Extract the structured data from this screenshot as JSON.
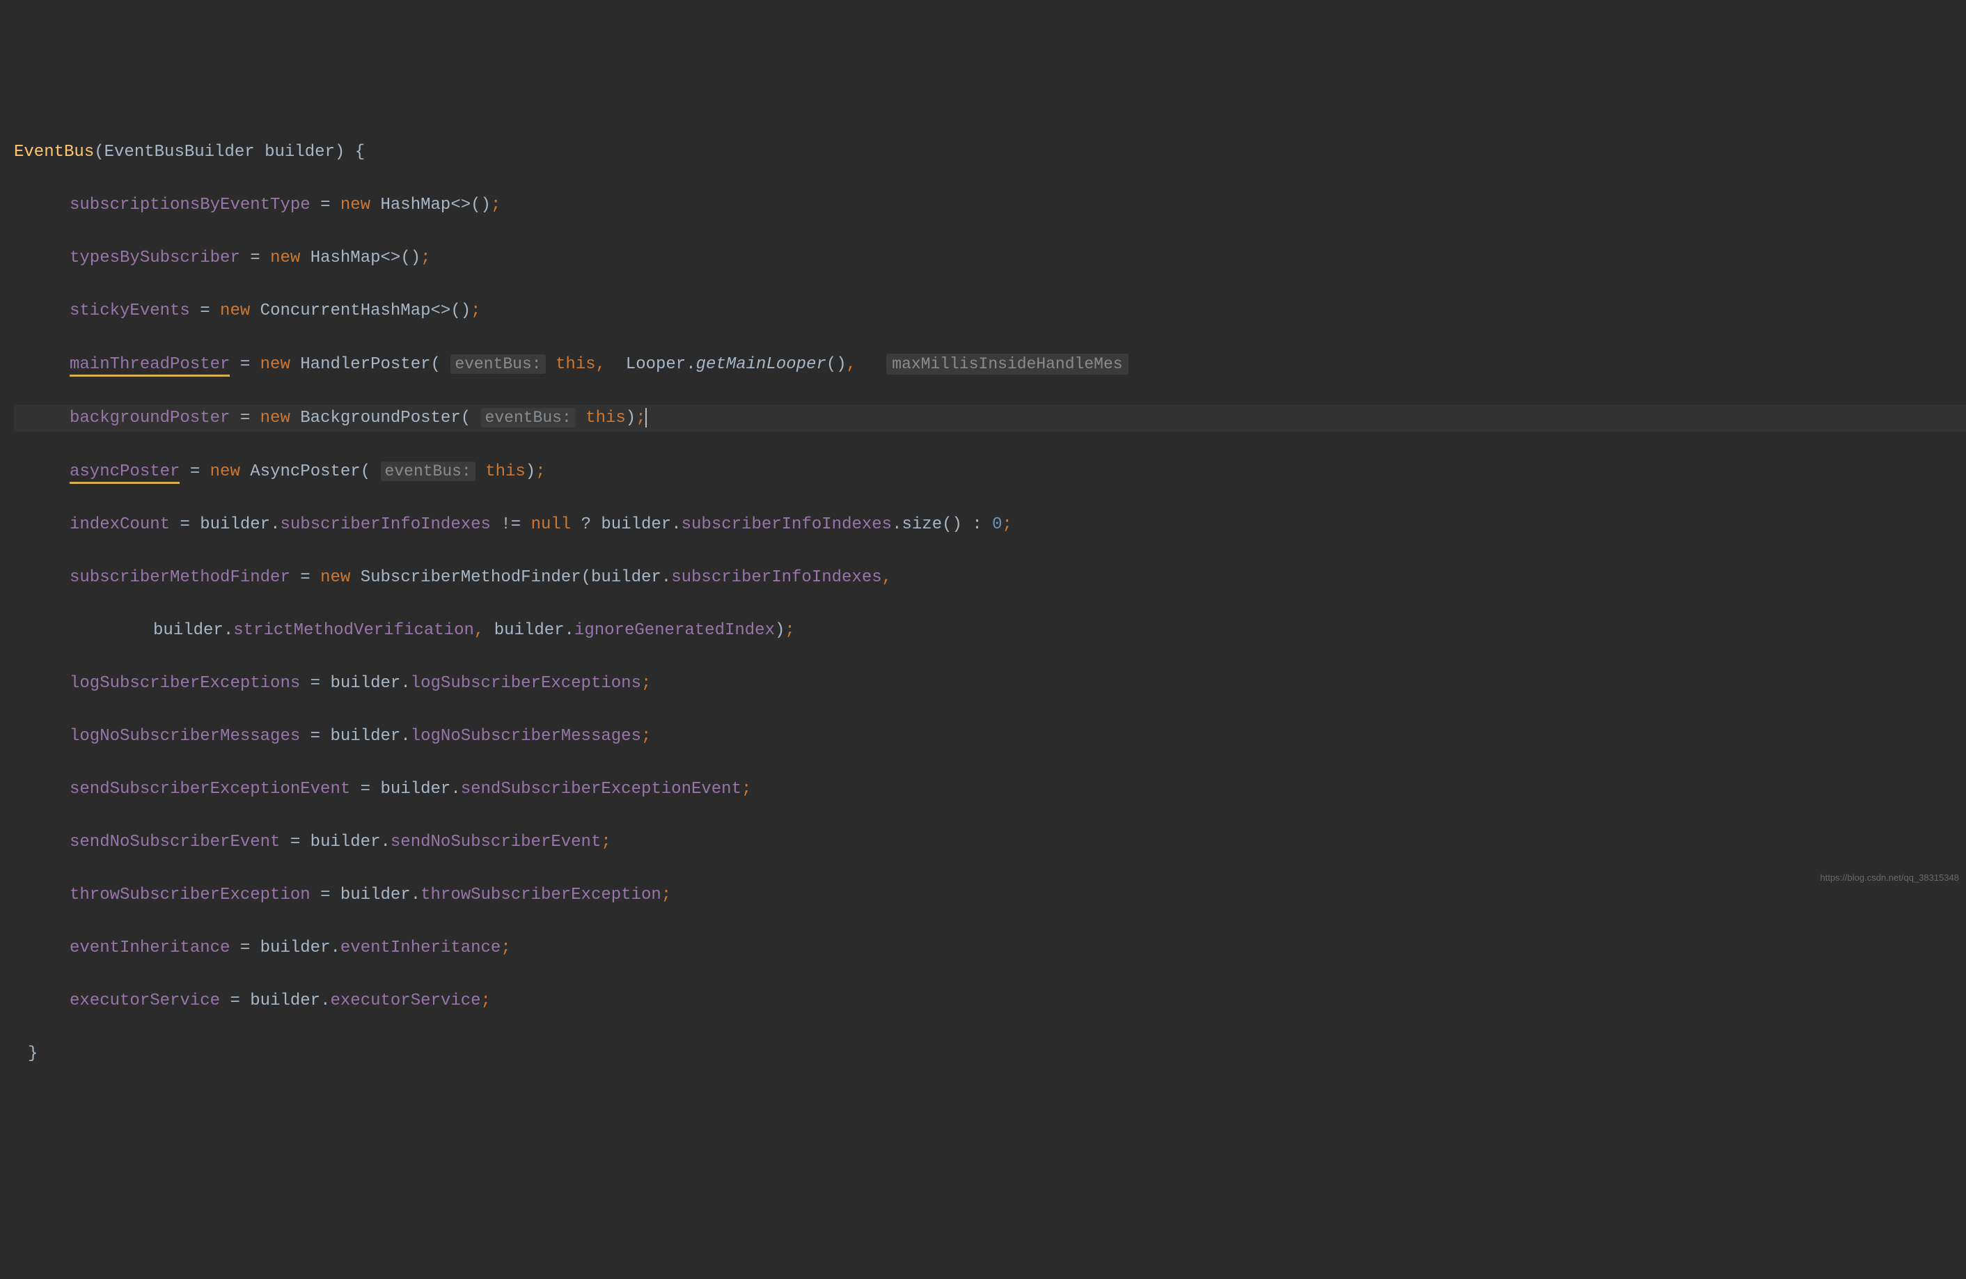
{
  "code": {
    "method_name": "EventBus",
    "param_type": "EventBusBuilder",
    "param_name": "builder",
    "kw_new": "new",
    "kw_this": "this",
    "kw_null": "null",
    "num_zero": "0",
    "l1_field": "subscriptionsByEventType",
    "l1_type": "HashMap",
    "l2_field": "typesBySubscriber",
    "l2_type": "HashMap",
    "l3_field": "stickyEvents",
    "l3_type": "ConcurrentHashMap",
    "l4_field": "mainThreadPoster",
    "l4_type": "HandlerPoster",
    "l4_hint1": "eventBus:",
    "l4_looper": "Looper",
    "l4_method": "getMainLooper",
    "l4_hint2": "maxMillisInsideHandleMes",
    "l5_field": "backgroundPoster",
    "l5_type": "BackgroundPoster",
    "l5_hint": "eventBus:",
    "l6_field": "asyncPoster",
    "l6_type": "AsyncPoster",
    "l6_hint": "eventBus:",
    "l7_field": "indexCount",
    "l7_builder": "builder",
    "l7_prop": "subscriberInfoIndexes",
    "l7_method": "size",
    "l8_field": "subscriberMethodFinder",
    "l8_type": "SubscriberMethodFinder",
    "l8_builder": "builder",
    "l8_prop": "subscriberInfoIndexes",
    "l9_builder": "builder",
    "l9_prop1": "strictMethodVerification",
    "l9_prop2": "ignoreGeneratedIndex",
    "l10_field": "logSubscriberExceptions",
    "l10_builder": "builder",
    "l10_prop": "logSubscriberExceptions",
    "l11_field": "logNoSubscriberMessages",
    "l11_builder": "builder",
    "l11_prop": "logNoSubscriberMessages",
    "l12_field": "sendSubscriberExceptionEvent",
    "l12_builder": "builder",
    "l12_prop": "sendSubscriberExceptionEvent",
    "l13_field": "sendNoSubscriberEvent",
    "l13_builder": "builder",
    "l13_prop": "sendNoSubscriberEvent",
    "l14_field": "throwSubscriberException",
    "l14_builder": "builder",
    "l14_prop": "throwSubscriberException",
    "l15_field": "eventInheritance",
    "l15_builder": "builder",
    "l15_prop": "eventInheritance",
    "l16_field": "executorService",
    "l16_builder": "builder",
    "l16_prop": "executorService"
  },
  "watermark": "https://blog.csdn.net/qq_38315348"
}
